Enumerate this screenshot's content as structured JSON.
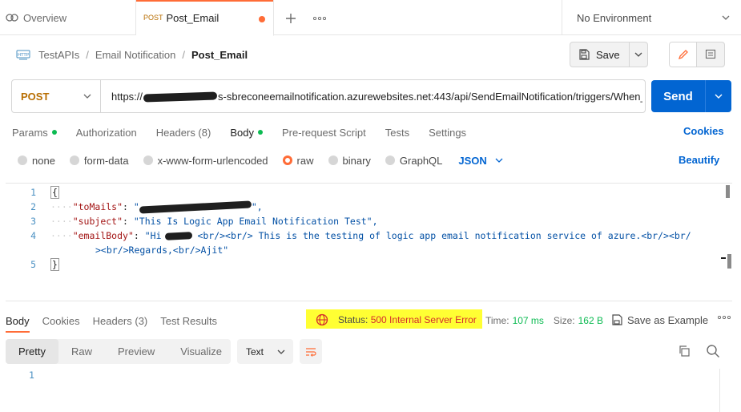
{
  "tabs": {
    "overview": "Overview",
    "active_method": "POST",
    "active_name": "Post_Email"
  },
  "environment": {
    "selected": "No Environment"
  },
  "breadcrumb": {
    "collection": "TestAPIs",
    "folder": "Email Notification",
    "request": "Post_Email"
  },
  "toolbar": {
    "save_label": "Save"
  },
  "request": {
    "method": "POST",
    "url_prefix": "https://",
    "url_rest": "s-sbreconeemailnotification.azurewebsites.net:443/api/SendEmailNotification/triggers/When_...",
    "send_label": "Send"
  },
  "request_tabs": {
    "params": "Params",
    "authorization": "Authorization",
    "headers": "Headers (8)",
    "body": "Body",
    "pre_request": "Pre-request Script",
    "tests": "Tests",
    "settings": "Settings",
    "cookies": "Cookies"
  },
  "body_types": {
    "none": "none",
    "form_data": "form-data",
    "urlencoded": "x-www-form-urlencoded",
    "raw": "raw",
    "binary": "binary",
    "graphql": "GraphQL",
    "language": "JSON",
    "beautify": "Beautify"
  },
  "editor": {
    "line_numbers": [
      "1",
      "2",
      "3",
      "4",
      "5"
    ],
    "open_brace": "{",
    "close_brace": "}",
    "to_key": "\"toMails\"",
    "to_val_start": "\"",
    "to_val_end": "\",",
    "subject_key": "\"subject\"",
    "subject_val": "\"This Is Logic App Email Notification Test\",",
    "body_key": "\"emailBody\"",
    "body_val_start": "\"Hi",
    "body_val_rest": " <br/><br/> This is the testing of logic app email notification service of azure.<br/><br/",
    "body_val_wrap": "><br/>Regards,<br/>Ajit\""
  },
  "response": {
    "tabs": {
      "body": "Body",
      "cookies": "Cookies",
      "headers": "Headers (3)",
      "test_results": "Test Results"
    },
    "status_label": "Status:",
    "status_value": "500 Internal Server Error",
    "time_label": "Time:",
    "time_value": "107 ms",
    "size_label": "Size:",
    "size_value": "162 B",
    "save_example": "Save as Example",
    "views": {
      "pretty": "Pretty",
      "raw": "Raw",
      "preview": "Preview",
      "visualize": "Visualize"
    },
    "format": "Text",
    "line_numbers": [
      "1"
    ]
  },
  "colors": {
    "accent": "#ff6c37",
    "send_blue": "#0265d2",
    "status_highlight": "#ffff33",
    "success_green": "#0cbb52",
    "method_post": "#b86e02"
  }
}
